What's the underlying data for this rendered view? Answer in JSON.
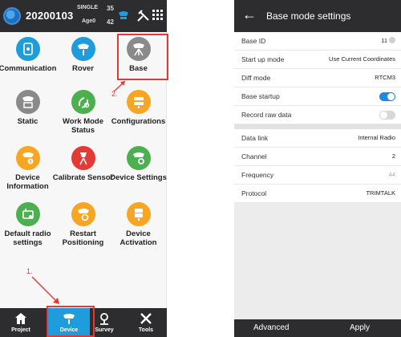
{
  "left_screen": {
    "header": {
      "project_number": "20200103",
      "status_mode": "SINGLE",
      "status_age": "Age0",
      "sat_count_1": "35",
      "sat_count_2": "42"
    },
    "grid": [
      {
        "label": "Communication",
        "icon": "communication-icon",
        "color": "#1e9cdc"
      },
      {
        "label": "Rover",
        "icon": "rover-icon",
        "color": "#1e9cdc"
      },
      {
        "label": "Base",
        "icon": "base-icon",
        "color": "#8a8a8a"
      },
      {
        "label": "Static",
        "icon": "static-icon",
        "color": "#8a8a8a"
      },
      {
        "label": "Work Mode Status",
        "icon": "work-mode-icon",
        "color": "#4caf50"
      },
      {
        "label": "Configurations",
        "icon": "configurations-icon",
        "color": "#f6a623"
      },
      {
        "label": "Device Information",
        "icon": "device-info-icon",
        "color": "#f6a623"
      },
      {
        "label": "Calibrate Sensor",
        "icon": "calibrate-icon",
        "color": "#e53935"
      },
      {
        "label": "Device Settings",
        "icon": "device-settings-icon",
        "color": "#4caf50"
      },
      {
        "label": "Default radio settings",
        "icon": "radio-settings-icon",
        "color": "#4caf50"
      },
      {
        "label": "Restart Positioning",
        "icon": "restart-icon",
        "color": "#f6a623"
      },
      {
        "label": "Device Activation",
        "icon": "activation-icon",
        "color": "#f6a623"
      }
    ],
    "bottom_tabs": [
      {
        "label": "Project",
        "icon": "home-icon",
        "active": false
      },
      {
        "label": "Device",
        "icon": "device-icon",
        "active": true
      },
      {
        "label": "Survey",
        "icon": "survey-icon",
        "active": false
      },
      {
        "label": "Tools",
        "icon": "tools-icon",
        "active": false
      }
    ],
    "annotations": {
      "step1": "1.",
      "step2": "2."
    }
  },
  "right_screen": {
    "title": "Base mode settings",
    "rows": [
      {
        "key": "Base ID",
        "value": "11"
      },
      {
        "key": "Start up mode",
        "value": "Use Current Coordinates"
      },
      {
        "key": "Diff mode",
        "value": "RTCM3"
      },
      {
        "key": "Base startup",
        "toggle": true
      },
      {
        "key": "Record raw data",
        "toggle": false
      },
      {
        "key": "Data link",
        "value": "Internal Radio"
      },
      {
        "key": "Channel",
        "value": "2"
      },
      {
        "key": "Frequency",
        "value": "44"
      },
      {
        "key": "Protocol",
        "value": "TRIMTALK"
      }
    ],
    "advanced_label": "Advanced",
    "apply_label": "Apply"
  },
  "colors": {
    "accent_blue": "#1e9cdc",
    "toggle_on": "#1e88e5",
    "header_dark": "#2d2d30",
    "annotation_red": "#e53935"
  }
}
